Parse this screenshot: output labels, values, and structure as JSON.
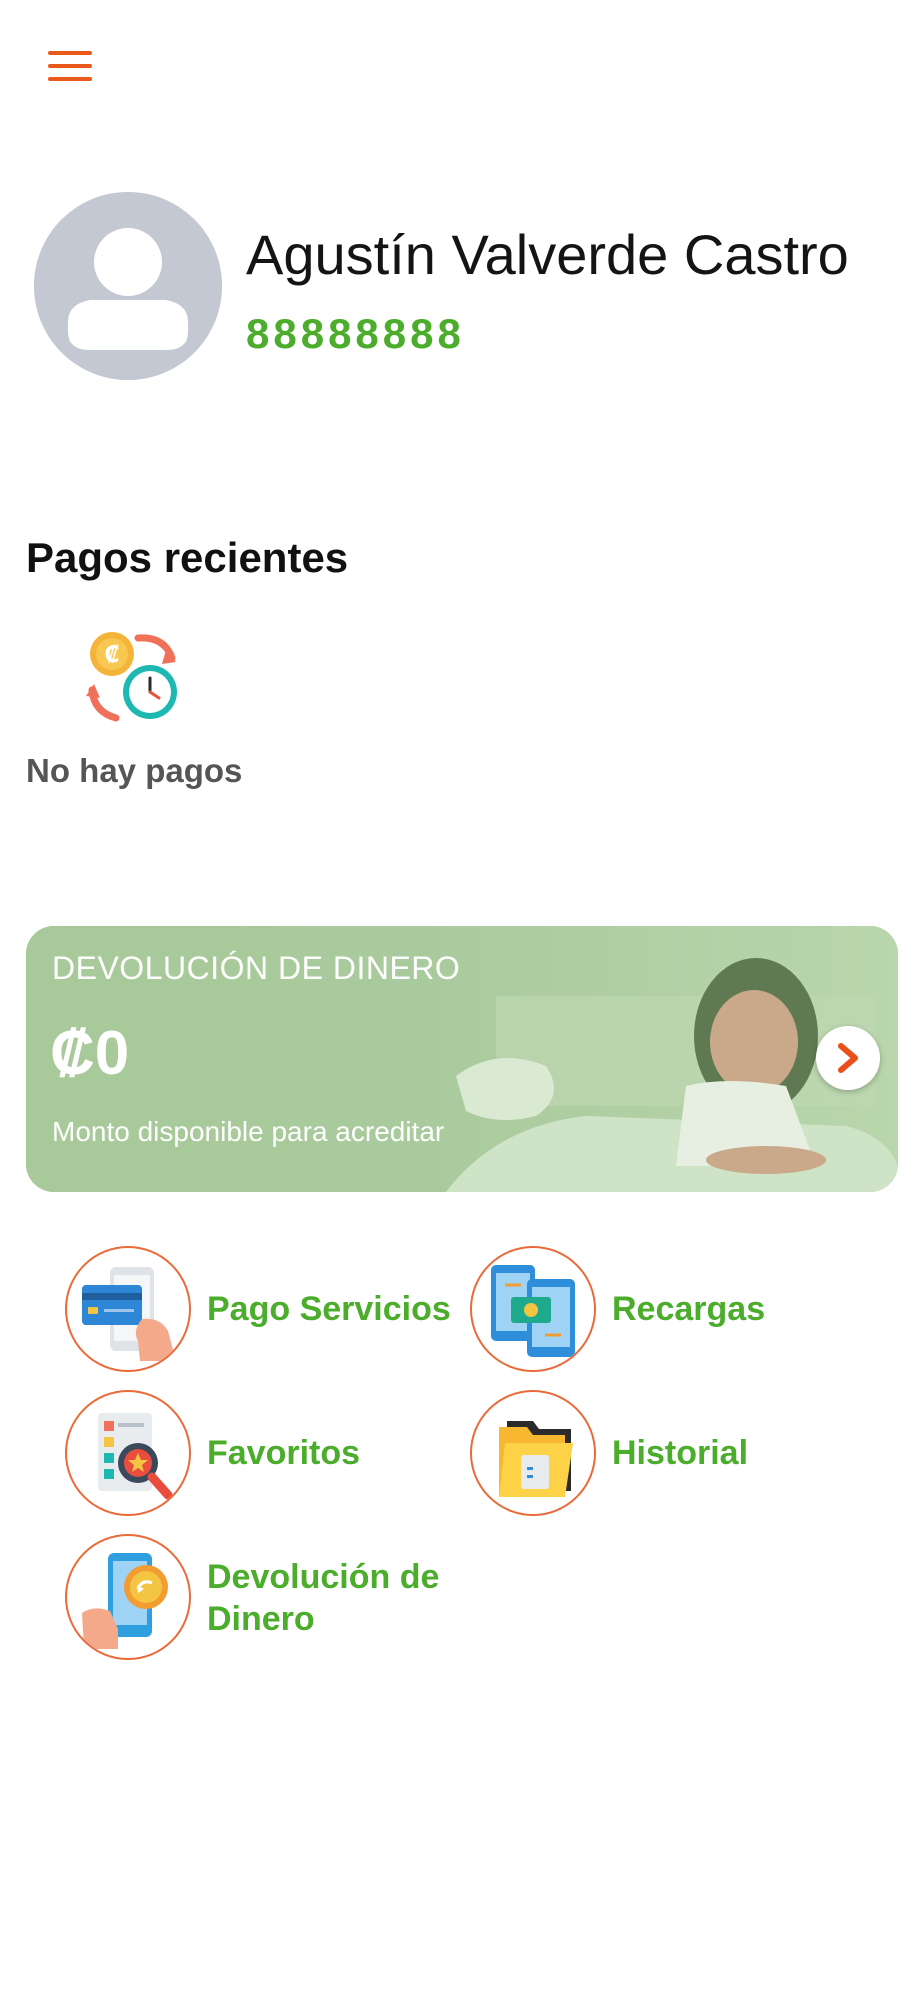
{
  "header": {
    "menu_icon": "hamburger-menu-icon",
    "accent": "#ea5a1c"
  },
  "profile": {
    "avatar_icon": "user-avatar-placeholder-icon",
    "name": "Agustín Valverde Castro",
    "phone": "88888888",
    "phone_color": "#4bad2b"
  },
  "recent_payments": {
    "title": "Pagos recientes",
    "empty_icon": "payment-clock-icon",
    "empty_text": "No hay pagos"
  },
  "refund_banner": {
    "title": "DEVOLUCIÓN DE DINERO",
    "amount": "₡0",
    "subtitle": "Monto disponible para acreditar",
    "arrow_icon": "chevron-right-icon"
  },
  "actions": [
    {
      "label": "Pago Servicios",
      "icon": "card-payment-icon"
    },
    {
      "label": "Recargas",
      "icon": "phone-recharge-icon"
    },
    {
      "label": "Favoritos",
      "icon": "favorites-icon"
    },
    {
      "label": "Historial",
      "icon": "folder-history-icon"
    },
    {
      "label_line1": "Devolución de",
      "label_line2": "Dinero",
      "icon": "money-return-icon"
    }
  ]
}
